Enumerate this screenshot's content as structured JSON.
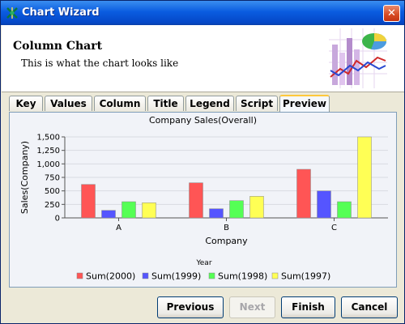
{
  "window": {
    "title": "Chart Wizard",
    "close_glyph": "✕",
    "app_icon": "chart-wizard-icon"
  },
  "header": {
    "title": "Column Chart",
    "subtitle": "This is what the chart looks like"
  },
  "tabs": [
    {
      "label": "Key",
      "active": false
    },
    {
      "label": "Values",
      "active": false
    },
    {
      "label": "Column",
      "active": false
    },
    {
      "label": "Title",
      "active": false
    },
    {
      "label": "Legend",
      "active": false
    },
    {
      "label": "Script",
      "active": false
    },
    {
      "label": "Preview",
      "active": true
    }
  ],
  "chart_data": {
    "type": "bar",
    "title": "Company Sales(Overall)",
    "xlabel": "Company",
    "ylabel": "Sales(Company)",
    "categories": [
      "A",
      "B",
      "C"
    ],
    "ylim": [
      0,
      1500
    ],
    "yticks": [
      "0",
      "250",
      "500",
      "750",
      "1,000",
      "1,250",
      "1,500"
    ],
    "grid": true,
    "legend_title": "Year",
    "legend_position": "bottom",
    "series": [
      {
        "name": "Sum(2000)",
        "color": "#ff5555",
        "values": [
          620,
          650,
          900
        ]
      },
      {
        "name": "Sum(1999)",
        "color": "#5555ff",
        "values": [
          140,
          170,
          500
        ]
      },
      {
        "name": "Sum(1998)",
        "color": "#55ff55",
        "values": [
          300,
          320,
          300
        ]
      },
      {
        "name": "Sum(1997)",
        "color": "#ffff55",
        "values": [
          280,
          400,
          1500
        ]
      }
    ]
  },
  "buttons": {
    "previous": "Previous",
    "next": "Next",
    "finish": "Finish",
    "cancel": "Cancel"
  }
}
